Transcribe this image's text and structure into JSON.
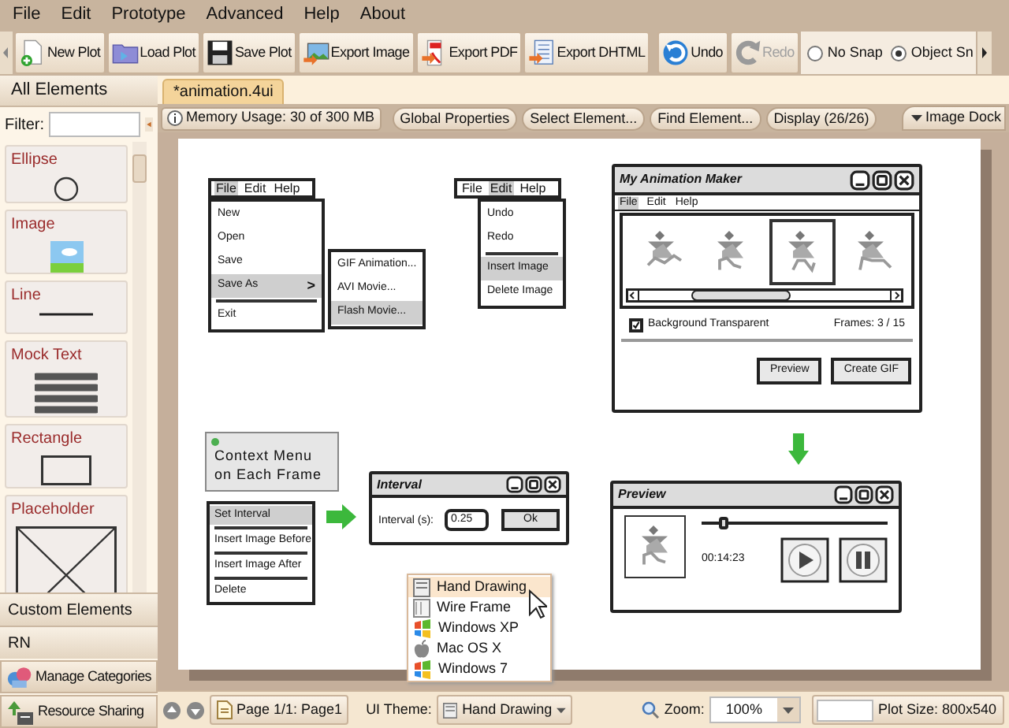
{
  "menu": [
    "File",
    "Edit",
    "Prototype",
    "Advanced",
    "Help",
    "About"
  ],
  "toolbar": {
    "buttons": [
      {
        "label": "New Plot",
        "disabled": false
      },
      {
        "label": "Load Plot",
        "disabled": false
      },
      {
        "label": "Save Plot",
        "disabled": false
      },
      {
        "label": "Export Image",
        "disabled": false
      },
      {
        "label": "Export PDF",
        "disabled": false
      },
      {
        "label": "Export DHTML",
        "disabled": false
      },
      {
        "label": "Undo",
        "disabled": false
      },
      {
        "label": "Redo",
        "disabled": true
      }
    ],
    "snap_options": [
      {
        "label": "No Snap",
        "selected": false
      },
      {
        "label": "Object Sn",
        "selected": true
      }
    ]
  },
  "sidebar": {
    "title": "All Elements",
    "filter_label": "Filter:",
    "elements": [
      {
        "label": "Ellipse",
        "kind": "ellipse"
      },
      {
        "label": "Image",
        "kind": "image"
      },
      {
        "label": "Line",
        "kind": "line"
      },
      {
        "label": "Mock Text",
        "kind": "mock_text"
      },
      {
        "label": "Rectangle",
        "kind": "rectangle"
      },
      {
        "label": "Placeholder",
        "kind": "placeholder"
      }
    ],
    "categories": [
      "Custom Elements",
      "RN"
    ],
    "buttons": [
      "Manage Categories",
      "Resource Sharing"
    ]
  },
  "document_tabs": [
    {
      "label": "*animation.4ui",
      "selected": true
    }
  ],
  "canvas_toolbar": {
    "memory": "Memory Usage: 30 of 300 MB",
    "buttons": [
      "Global Properties",
      "Select Element...",
      "Find Element...",
      "Display (26/26)"
    ],
    "dock": "Image Dock"
  },
  "canvas": {
    "file_menu": {
      "menubar": [
        {
          "label": "File",
          "selected": true
        },
        {
          "label": "Edit",
          "selected": false
        },
        {
          "label": "Help",
          "selected": false
        }
      ],
      "items": [
        {
          "kind": "item",
          "label": "New",
          "selected": false
        },
        {
          "kind": "item",
          "label": "Open",
          "selected": false
        },
        {
          "kind": "item",
          "label": "Save",
          "selected": false
        },
        {
          "kind": "item",
          "label": "Save As",
          "selected": true,
          "arrow": ">"
        },
        {
          "kind": "separator"
        },
        {
          "kind": "item",
          "label": "Exit",
          "selected": false
        }
      ]
    },
    "save_as_submenu": {
      "items": [
        {
          "kind": "item",
          "label": "GIF Animation...",
          "selected": false
        },
        {
          "kind": "item",
          "label": "AVI Movie...",
          "selected": false
        },
        {
          "kind": "item",
          "label": "Flash Movie...",
          "selected": true
        }
      ]
    },
    "edit_menu": {
      "menubar": [
        {
          "label": "File",
          "selected": false
        },
        {
          "label": "Edit",
          "selected": true
        },
        {
          "label": "Help",
          "selected": false
        }
      ],
      "items": [
        {
          "kind": "item",
          "label": "Undo",
          "selected": false
        },
        {
          "kind": "item",
          "label": "Redo",
          "selected": false
        },
        {
          "kind": "separator"
        },
        {
          "kind": "item",
          "label": "Insert Image",
          "selected": true
        },
        {
          "kind": "item",
          "label": "Delete Image",
          "selected": false
        }
      ]
    },
    "app_window": {
      "title": "My Animation Maker",
      "menubar": [
        {
          "label": "File",
          "selected": true
        },
        {
          "label": "Edit",
          "selected": false
        },
        {
          "label": "Help",
          "selected": false
        }
      ],
      "frames": [
        {
          "selected": false
        },
        {
          "selected": false
        },
        {
          "selected": true
        },
        {
          "selected": false
        }
      ],
      "checkbox": {
        "label": "Background Transparent",
        "checked": true
      },
      "frame_count": "Frames: 3 / 15",
      "buttons": [
        "Preview",
        "Create GIF"
      ]
    },
    "note": {
      "text": "Context Menu on Each Frame"
    },
    "context_menu": {
      "items": [
        {
          "label": "Set Interval",
          "selected": true
        },
        {
          "label": "Insert Image Before",
          "selected": false
        },
        {
          "label": "Insert Image After",
          "selected": false
        },
        {
          "label": "Delete",
          "selected": false
        }
      ]
    },
    "interval_dialog": {
      "title": "Interval",
      "label": "Interval (s):",
      "value": "0.25",
      "button": "Ok"
    },
    "preview_window": {
      "title": "Preview",
      "level": 0.12,
      "time": "00:14:23"
    }
  },
  "theme_popup": {
    "items": [
      {
        "label": "Hand Drawing",
        "kind": "hand_drawing",
        "selected": true
      },
      {
        "label": "Wire Frame",
        "kind": "wire_frame",
        "selected": false
      },
      {
        "label": "Windows XP",
        "kind": "windows",
        "selected": false
      },
      {
        "label": "Mac OS X",
        "kind": "apple",
        "selected": false
      },
      {
        "label": "Windows 7",
        "kind": "windows",
        "selected": false
      }
    ]
  },
  "status_bar": {
    "page": "Page 1/1: Page1",
    "theme_label": "UI Theme:",
    "theme": "Hand Drawing",
    "zoom_label": "Zoom:",
    "zoom": "100%",
    "plot_size": "Plot Size: 800x540"
  }
}
